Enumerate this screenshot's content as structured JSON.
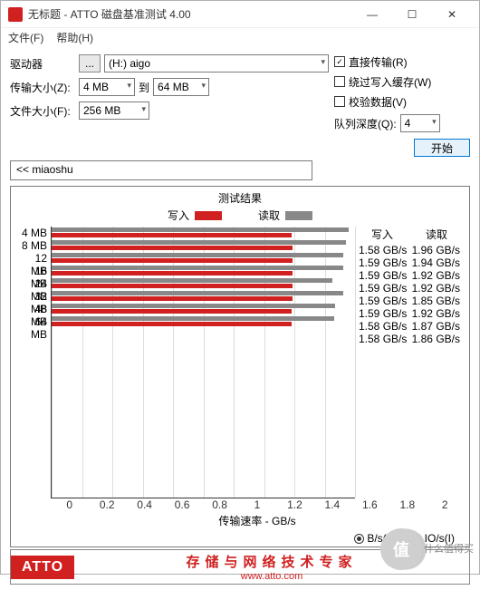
{
  "window": {
    "title": "无标题 - ATTO 磁盘基准测试 4.00"
  },
  "menu": {
    "file": "文件(F)",
    "help": "帮助(H)"
  },
  "cfg": {
    "drive_lbl": "驱动器",
    "browse": "...",
    "drive_val": "(H:) aigo",
    "xfer_lbl": "传输大小(Z):",
    "xfer_from": "4 MB",
    "to": "到",
    "xfer_to": "64 MB",
    "fsize_lbl": "文件大小(F):",
    "fsize_val": "256 MB",
    "direct": "直接传输(R)",
    "bypass": "绕过写入缓存(W)",
    "verify": "校验数据(V)",
    "qd_lbl": "队列深度(Q):",
    "qd_val": "4",
    "start": "开始",
    "direct_on": true,
    "bypass_on": false,
    "verify_on": false
  },
  "desc": "<< miaoshu",
  "chart_title": "测试结果",
  "legend": {
    "write": "写入",
    "read": "读取"
  },
  "chart_data": {
    "type": "bar",
    "xlabel": "传输速率 - GB/s",
    "xlim": [
      0,
      2
    ],
    "xticks": [
      0,
      0.2,
      0.4,
      0.6,
      0.8,
      1.0,
      1.2,
      1.4,
      1.6,
      1.8,
      2
    ],
    "categories": [
      "4 MB",
      "8 MB",
      "12 MB",
      "16 MB",
      "24 MB",
      "32 MB",
      "48 MB",
      "64 MB"
    ],
    "series": [
      {
        "name": "写入",
        "values": [
          1.58,
          1.59,
          1.59,
          1.59,
          1.59,
          1.59,
          1.58,
          1.58
        ],
        "unit": "GB/s"
      },
      {
        "name": "读取",
        "values": [
          1.96,
          1.94,
          1.92,
          1.92,
          1.85,
          1.92,
          1.87,
          1.86
        ],
        "unit": "GB/s"
      }
    ]
  },
  "units": {
    "bs": "B/s(B)",
    "ios": "IO/s(I)",
    "sel": "bs"
  },
  "footer": {
    "logo": "ATTO",
    "slogan": "存储与网络技术专家",
    "url": "www.atto.com"
  },
  "watermark": {
    "mark": "值",
    "text": "什么值得买"
  }
}
